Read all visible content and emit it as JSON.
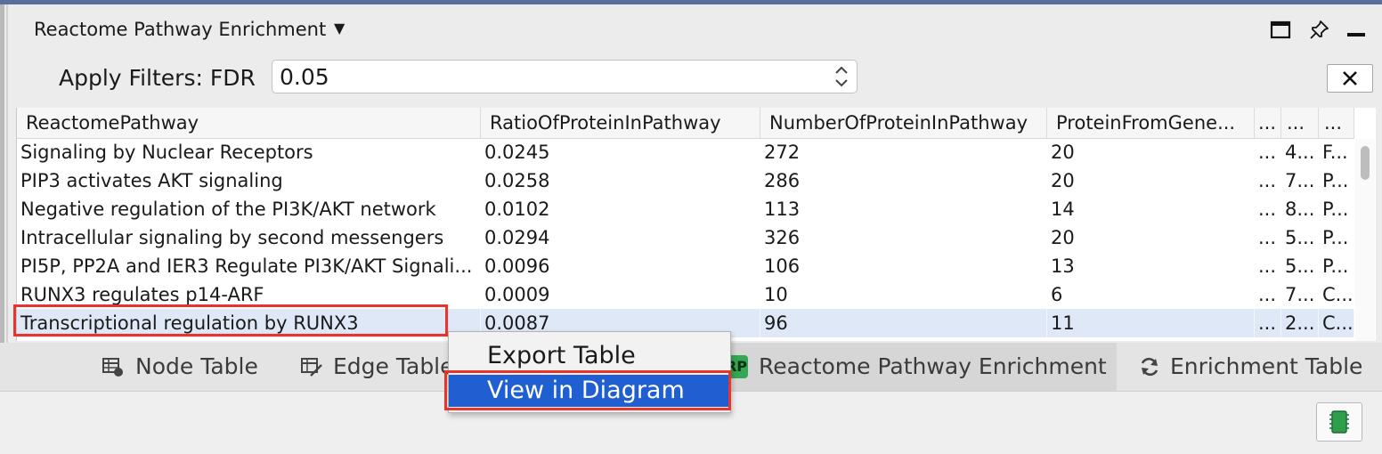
{
  "panel": {
    "title": "Reactome Pathway Enrichment",
    "dropdown_icon": "caret-down-icon",
    "header_icons": [
      "maximize-icon",
      "pin-icon",
      "minimize-icon"
    ]
  },
  "filter": {
    "label": "Apply Filters:  FDR",
    "value": "0.05",
    "clear_label": "✕"
  },
  "table": {
    "columns": [
      "ReactomePathway",
      "RatioOfProteinInPathway",
      "NumberOfProteinInPathway",
      "ProteinFromGene...",
      "...",
      "...",
      "..."
    ],
    "rows": [
      [
        "Signaling by Nuclear Receptors",
        "0.0245",
        "272",
        "20",
        "...",
        "4...",
        "F..."
      ],
      [
        "PIP3 activates AKT signaling",
        "0.0258",
        "286",
        "20",
        "...",
        "7...",
        "P..."
      ],
      [
        "Negative regulation of the PI3K/AKT network",
        "0.0102",
        "113",
        "14",
        "...",
        "8...",
        "P..."
      ],
      [
        "Intracellular signaling by second messengers",
        "0.0294",
        "326",
        "20",
        "...",
        "5...",
        "P..."
      ],
      [
        "PI5P, PP2A and IER3 Regulate PI3K/AKT Signali...",
        "0.0096",
        "106",
        "13",
        "...",
        "5...",
        "P..."
      ],
      [
        "RUNX3 regulates p14-ARF",
        "0.0009",
        "10",
        "6",
        "...",
        "7...",
        "C..."
      ],
      [
        "Transcriptional regulation by RUNX3",
        "0.0087",
        "96",
        "11",
        "...",
        "2...",
        "C..."
      ]
    ],
    "selected_row": 6
  },
  "tabs": [
    {
      "label": "Node Table",
      "icon": "node-table-icon"
    },
    {
      "label": "Edge Table",
      "icon": "edge-table-icon"
    },
    {
      "label": "Reactome Pathway Enrichment",
      "icon": "RP",
      "active": true
    },
    {
      "label": "Enrichment Table",
      "icon": "refresh-icon"
    }
  ],
  "context_menu": {
    "items": [
      "Export Table",
      "View in Diagram"
    ],
    "highlighted": 1
  },
  "status": {
    "memory_icon": "memory-chip-icon"
  },
  "colors": {
    "selection": "#dfe8f7",
    "menu_highlight": "#1f5fd1",
    "annotation_red": "#e8342a",
    "rp_badge": "#32a852"
  }
}
